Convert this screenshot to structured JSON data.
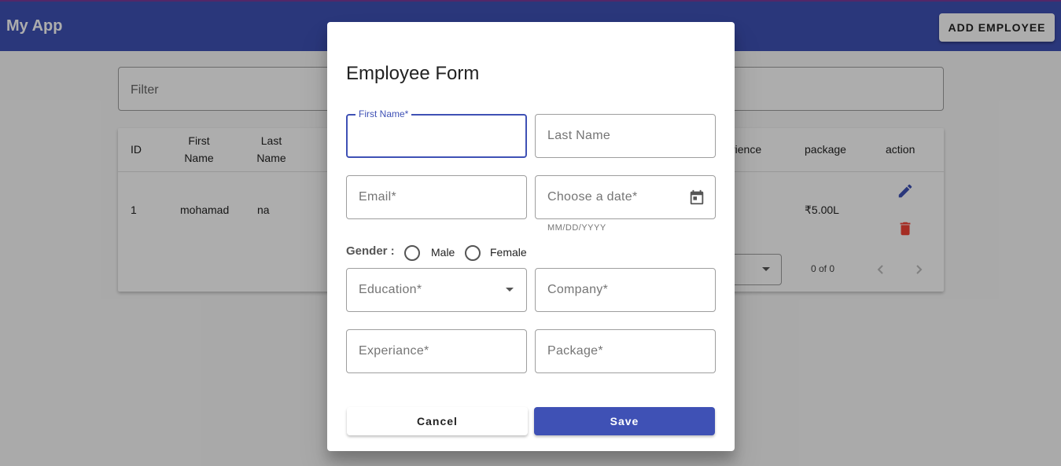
{
  "app": {
    "title": "My App",
    "add_button": "ADD EMPLOYEE"
  },
  "filter": {
    "label": "Filter"
  },
  "table": {
    "headers": [
      "ID",
      "First Name",
      "Last Name",
      "rience",
      "package",
      "action"
    ],
    "rows": [
      {
        "id": "1",
        "first_name": "mohamad",
        "last_name": "na",
        "package": "₹5.00L"
      }
    ],
    "paginator": {
      "range": "0 of 0"
    }
  },
  "dialog": {
    "title": "Employee Form",
    "first_name_label": "First Name*",
    "last_name_label": "Last Name",
    "email_label": "Email*",
    "date_label": "Choose a date*",
    "date_hint": "MM/DD/YYYY",
    "gender_label": "Gender :",
    "gender_options": [
      "Male",
      "Female"
    ],
    "education_label": "Education*",
    "company_label": "Company*",
    "experience_label": "Experiance*",
    "package_label": "Package*",
    "cancel_label": "Cancel",
    "save_label": "Save"
  },
  "colors": {
    "primary": "#3f51b5",
    "delete": "#f44336"
  },
  "icons": [
    "calendar-icon",
    "dropdown-arrow-icon",
    "edit-icon",
    "delete-icon",
    "chevron-left-icon",
    "chevron-right-icon"
  ]
}
